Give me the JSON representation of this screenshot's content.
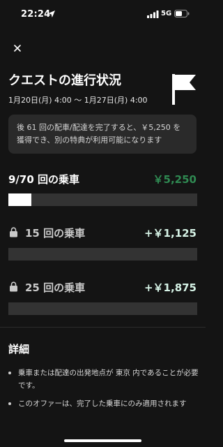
{
  "status_bar": {
    "time": "22:24",
    "network": "5G"
  },
  "header": {
    "title": "クエストの進行状況",
    "date_range": "1月20日(月) 4:00 〜 1月27日(月) 4:00"
  },
  "info": {
    "text": "後 61 回の配車/配達を完了すると、￥5,250 を獲得でき、別の特典が利用可能になります"
  },
  "tiers": [
    {
      "label": "9/70 回の乗車",
      "reward": "￥5,250",
      "locked": false,
      "progress": 0.12
    },
    {
      "label": "15 回の乗車",
      "reward": "+￥1,125",
      "locked": true,
      "progress": 0
    },
    {
      "label": "25 回の乗車",
      "reward": "+￥1,875",
      "locked": true,
      "progress": 0
    }
  ],
  "details": {
    "title": "詳細",
    "items": [
      "乗車または配達の出発地点が 東京 内であることが必要です。",
      "このオファーは、完了した乗車にのみ適用されます"
    ]
  },
  "icons": {
    "close": "close-icon",
    "flag": "flag-icon",
    "lock": "lock-icon",
    "location": "location-arrow-icon"
  },
  "colors": {
    "background": "#141414",
    "reward_main": "#2f8a52",
    "reward_bonus": "#d6f3e6",
    "info_box": "#2a2a2a",
    "bar_track": "#333333"
  }
}
